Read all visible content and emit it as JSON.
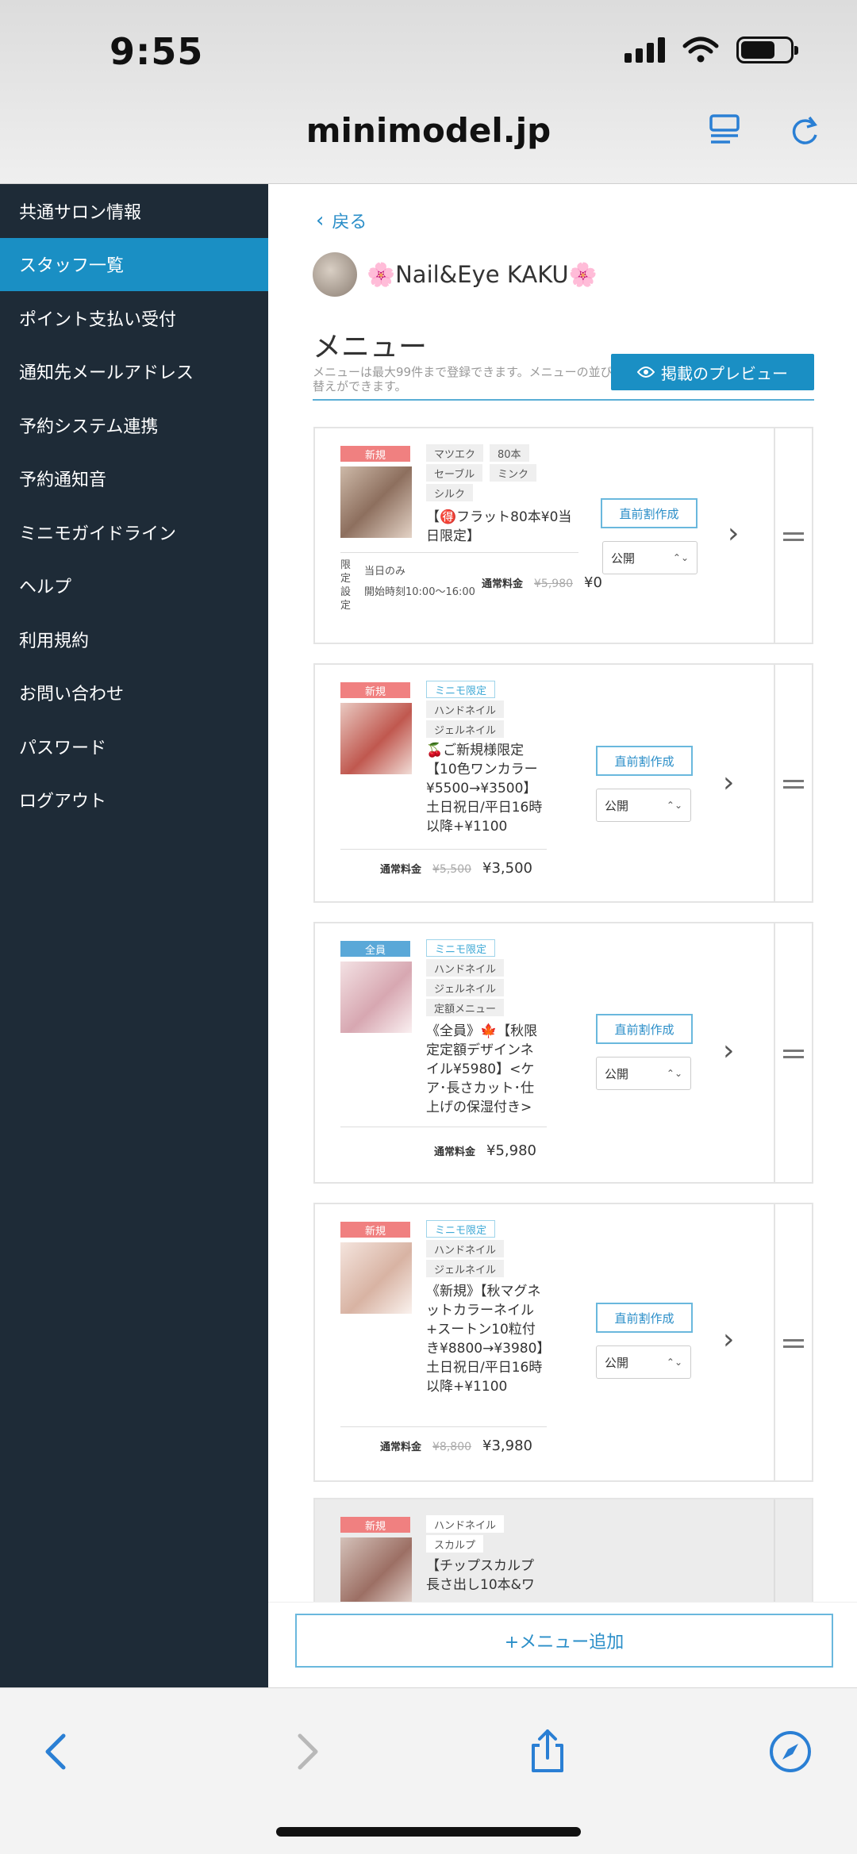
{
  "status_bar": {
    "time": "9:55"
  },
  "browser": {
    "url": "minimodel.jp"
  },
  "sidebar": {
    "items": [
      {
        "label": "共通サロン情報"
      },
      {
        "label": "スタッフ一覧"
      },
      {
        "label": "ポイント支払い受付"
      },
      {
        "label": "通知先メールアドレス"
      },
      {
        "label": "予約システム連携"
      },
      {
        "label": "予約通知音"
      },
      {
        "label": "ミニモガイドライン"
      },
      {
        "label": "ヘルプ"
      },
      {
        "label": "利用規約"
      },
      {
        "label": "お問い合わせ"
      },
      {
        "label": "パスワード"
      },
      {
        "label": "ログアウト"
      }
    ],
    "active_index": 1
  },
  "main": {
    "back_label": "戻る",
    "salon_name": "🌸Nail&Eye KAKU🌸",
    "menu_title": "メニュー",
    "menu_note": "メニューは最大99件まで登録できます。メニューの並び替えができます。",
    "preview_button": "掲載のプレビュー",
    "add_button": "+メニュー追加",
    "price_label": "通常料金",
    "discount_button": "直前割作成",
    "public_value": "公開",
    "cards": [
      {
        "main_tag": "新規",
        "tags": [
          "マツエク",
          "80本",
          "セーブル",
          "ミンク",
          "シルク"
        ],
        "desc": "【🉐フラット80本¥0当日限定】",
        "limited_label": "限定設定",
        "limited_1": "当日のみ",
        "limited_2": "開始時刻10:00〜16:00",
        "old_price": "¥5,980",
        "new_price": "¥0"
      },
      {
        "main_tag": "新規",
        "mini_tag": "ミニモ限定",
        "tags": [
          "ハンドネイル",
          "ジェルネイル"
        ],
        "desc": "🍒ご新規様限定【10色ワンカラー¥5500→¥3500】土日祝日/平日16時以降+¥1100",
        "old_price": "¥5,500",
        "new_price": "¥3,500"
      },
      {
        "main_tag": "全員",
        "mini_tag": "ミニモ限定",
        "tags": [
          "ハンドネイル",
          "ジェルネイル",
          "定額メニュー"
        ],
        "desc": "《全員》🍁【秋限定定額デザインネイル¥5980】<ケア･長さカット･仕上げの保湿付き>",
        "new_price": "¥5,980"
      },
      {
        "main_tag": "新規",
        "mini_tag": "ミニモ限定",
        "tags": [
          "ハンドネイル",
          "ジェルネイル"
        ],
        "desc": "《新規》【秋マグネットカラーネイル+スートン10粒付き¥8800→¥3980】土日祝日/平日16時以降+¥1100",
        "old_price": "¥8,800",
        "new_price": "¥3,980"
      },
      {
        "main_tag": "新規",
        "tags": [
          "ハンドネイル",
          "スカルプ"
        ],
        "desc": "【チップスカルプ長さ出し10本&ワ"
      }
    ]
  },
  "colors": {
    "accent": "#1a8fc4",
    "sidebar_bg": "#1e2b37",
    "tag_new": "#f08080",
    "tag_all": "#5aa8d8"
  },
  "icons": [
    "reader-icon",
    "reload-icon",
    "back-arrow-icon",
    "forward-arrow-icon",
    "share-icon",
    "compass-icon",
    "eye-icon",
    "chevron-right-icon",
    "drag-handle-icon"
  ]
}
